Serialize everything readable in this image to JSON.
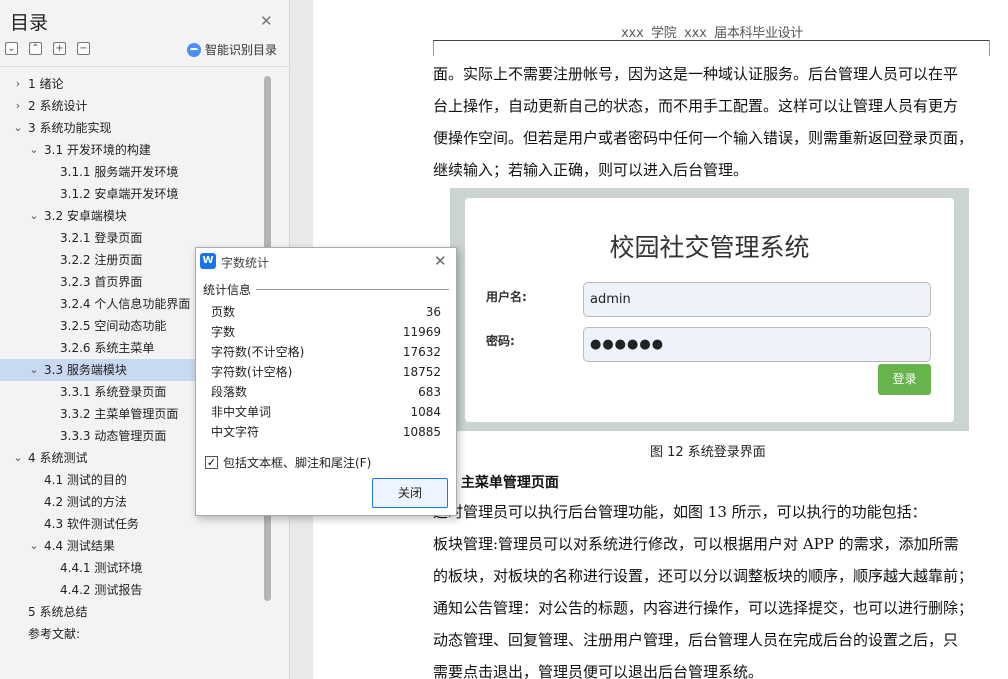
{
  "toc": {
    "title": "目录",
    "smart_label": "智能识别目录",
    "items": [
      {
        "chev": "›",
        "label": "1  绪论"
      },
      {
        "chev": "›",
        "label": "2  系统设计"
      },
      {
        "chev": "⌄",
        "label": "3  系统功能实现"
      },
      {
        "chev": "⌄",
        "label": "3.1 开发环境的构建"
      },
      {
        "chev": "",
        "label": "3.1.1  服务端开发环境"
      },
      {
        "chev": "",
        "label": "3.1.2  安卓端开发环境"
      },
      {
        "chev": "⌄",
        "label": "3.2  安卓端模块"
      },
      {
        "chev": "",
        "label": "3.2.1  登录页面"
      },
      {
        "chev": "",
        "label": "3.2.2  注册页面"
      },
      {
        "chev": "",
        "label": "3.2.3  首页界面"
      },
      {
        "chev": "",
        "label": "3.2.4  个人信息功能界面"
      },
      {
        "chev": "",
        "label": "3.2.5  空间动态功能"
      },
      {
        "chev": "",
        "label": "3.2.6  系统主菜单"
      },
      {
        "chev": "⌄",
        "label": "3.3  服务端模块"
      },
      {
        "chev": "",
        "label": "3.3.1  系统登录页面"
      },
      {
        "chev": "",
        "label": "3.3.2  主菜单管理页面"
      },
      {
        "chev": "",
        "label": "3.3.3  动态管理页面"
      },
      {
        "chev": "⌄",
        "label": "4  系统测试"
      },
      {
        "chev": "",
        "label": "4.1  测试的目的"
      },
      {
        "chev": "",
        "label": "4.2  测试的方法"
      },
      {
        "chev": "",
        "label": "4.3  软件测试任务"
      },
      {
        "chev": "⌄",
        "label": "4.4  测试结果"
      },
      {
        "chev": "",
        "label": "4.4.1 测试环境"
      },
      {
        "chev": "",
        "label": "4.4.2 测试报告"
      },
      {
        "chev": "",
        "label": "5  系统总结"
      },
      {
        "chev": "",
        "label": "参考文献:"
      }
    ]
  },
  "document": {
    "header": "xxx 学院 xxx 届本科毕业设计",
    "para1": [
      "面。实际上不需要注册帐号，因为这是一种域认证服务。后台管理人员可以在平",
      "台上操作，自动更新自己的状态，而不用手工配置。这样可以让管理人员有更方",
      "便操作空间。但若是用户或者密码中任何一个输入错误，则需重新返回登录页面，",
      "继续输入；若输入正确，则可以进入后台管理。"
    ],
    "figure": {
      "title": "校园社交管理系统",
      "username_label": "用户名:",
      "username_value": "admin",
      "password_label": "密码:",
      "password_value": "●●●●●●",
      "login_label": "登录"
    },
    "caption": "图 12 系统登录界面",
    "section_title": ".2  主菜单管理页面",
    "para2": [
      "    这时管理员可以执行后台管理功能，如图 13 所示，可以执行的功能包括：",
      "板块管理:管理员可以对系统进行修改，可以根据用户对 APP 的需求，添加所需",
      "的板块，对板块的名称进行设置，还可以分以调整板块的顺序，顺序越大越靠前；",
      "通知公告管理：对公告的标题，内容进行操作，可以选择提交，也可以进行删除；",
      "动态管理、回复管理、注册用户管理，后台管理人员在完成后台的设置之后，只",
      "需要点击退出，管理员便可以退出后台管理系统。"
    ]
  },
  "dialog": {
    "icon_text": "W",
    "title": "字数统计",
    "section": "统计信息",
    "stats": [
      {
        "label": "页数",
        "value": "36"
      },
      {
        "label": "字数",
        "value": "11969"
      },
      {
        "label": "字符数(不计空格)",
        "value": "17632"
      },
      {
        "label": "字符数(计空格)",
        "value": "18752"
      },
      {
        "label": "段落数",
        "value": "683"
      },
      {
        "label": "非中文单词",
        "value": "1084"
      },
      {
        "label": "中文字符",
        "value": "10885"
      }
    ],
    "checkbox_label": "包括文本框、脚注和尾注(F)",
    "checkbox_checked": true,
    "close_label": "关闭"
  }
}
